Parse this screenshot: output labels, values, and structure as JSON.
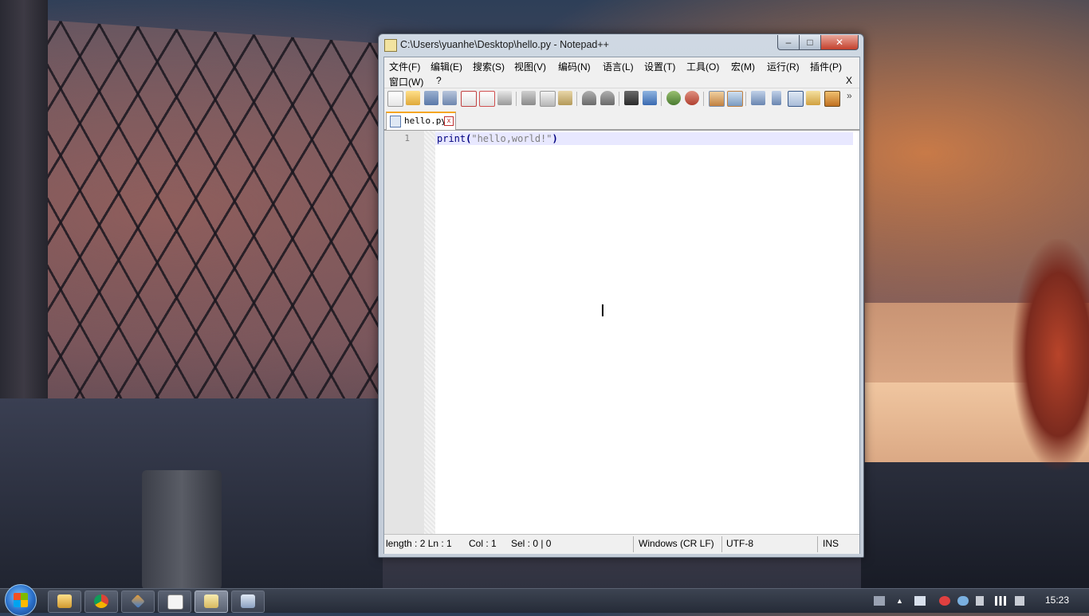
{
  "window": {
    "title": "C:\\Users\\yuanhe\\Desktop\\hello.py - Notepad++",
    "minimize_label": "–",
    "maximize_label": "□",
    "close_label": "✕"
  },
  "menu": {
    "items": [
      "文件(F)",
      "编辑(E)",
      "搜索(S)",
      "视图(V)",
      "编码(N)",
      "语言(L)",
      "设置(T)",
      "工具(O)",
      "宏(M)",
      "运行(R)",
      "插件(P)",
      "窗口(W)",
      "?"
    ],
    "close_doc": "X"
  },
  "toolbar": {
    "buttons": [
      "new-file",
      "open-file",
      "save",
      "save-all",
      "close",
      "close-all",
      "print",
      "cut",
      "copy",
      "paste",
      "undo",
      "redo",
      "find",
      "replace",
      "zoom-in",
      "zoom-out",
      "sync-vertical",
      "sync-horizontal",
      "word-wrap",
      "show-all-chars",
      "indent-guide",
      "user-defined-lang",
      "doc-map"
    ],
    "overflow": "»"
  },
  "tab": {
    "label": "hello.py",
    "close_label": "x"
  },
  "editor": {
    "line_number": "1",
    "code": {
      "keyword": "print",
      "open_paren": "(",
      "string": "\"hello,world!\"",
      "close_paren": ")"
    }
  },
  "status": {
    "length_ln": "length : 2   Ln : 1",
    "col": "Col : 1",
    "sel": "Sel : 0 | 0",
    "eol": "Windows (CR LF)",
    "encoding": "UTF-8",
    "mode": "INS"
  },
  "taskbar": {
    "clock": "15:23",
    "apps": [
      "file-explorer",
      "chrome",
      "app-diamond",
      "typora",
      "notepad-plus-plus",
      "remote-desktop"
    ]
  },
  "colors": {
    "accent": "#f5a623",
    "current_line": "#e8e8ff",
    "keyword": "#000080",
    "string": "#808080"
  }
}
